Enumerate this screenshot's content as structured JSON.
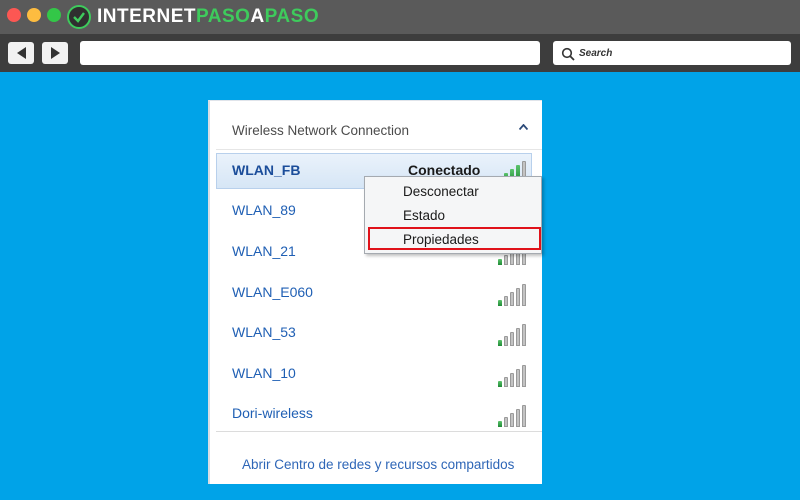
{
  "browser": {
    "brand_part1": "INTERNET",
    "brand_part2": "PASO",
    "brand_part3": "A",
    "brand_part4": "PASO",
    "search_placeholder": "Search",
    "back_icon": "back-arrow-icon",
    "forward_icon": "forward-arrow-icon"
  },
  "panel": {
    "header": "Wireless Network Connection",
    "collapse_icon": "chevron-up-icon",
    "networks": [
      {
        "name": "WLAN_FB",
        "status": "Conectado",
        "signal_bars": 4,
        "connected": true
      },
      {
        "name": "WLAN_89",
        "status": "",
        "signal_bars": 1
      },
      {
        "name": "WLAN_21",
        "status": "",
        "signal_bars": 1
      },
      {
        "name": "WLAN_E060",
        "status": "",
        "signal_bars": 1
      },
      {
        "name": "WLAN_53",
        "status": "",
        "signal_bars": 1
      },
      {
        "name": "WLAN_10",
        "status": "",
        "signal_bars": 1
      },
      {
        "name": "Dori-wireless",
        "status": "",
        "signal_bars": 1
      }
    ],
    "footer_link": "Abrir Centro de redes y recursos compartidos"
  },
  "context_menu": {
    "items": [
      "Desconectar",
      "Estado",
      "Propiedades"
    ],
    "highlighted_index": 2
  },
  "colors": {
    "background": "#00a3e8",
    "titlebar": "#5a5a5a",
    "toolbar": "#3d3d3d",
    "brand_green": "#3ecb5c",
    "link_blue": "#1f5fb4",
    "highlight_red": "#e0121a"
  }
}
